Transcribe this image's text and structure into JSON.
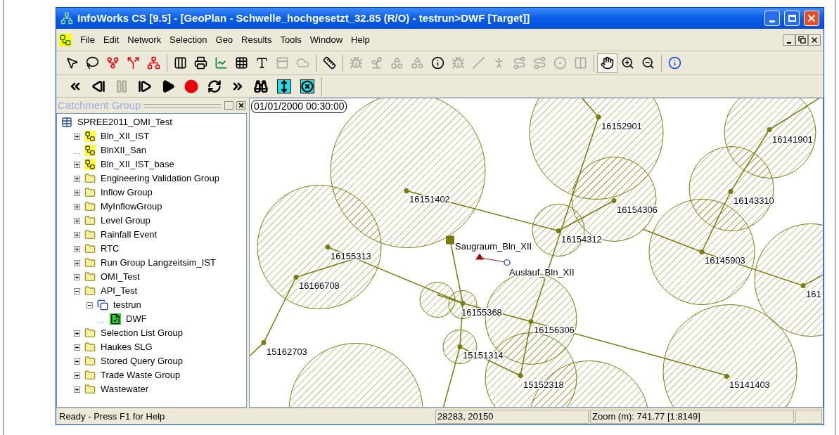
{
  "window": {
    "title": "InfoWorks CS [9.5] - [GeoPlan - Schwelle_hochgesetzt_32.85 (R/O) - testrun>DWF  [Target]]"
  },
  "menu": [
    "File",
    "Edit",
    "Network",
    "Selection",
    "Geo",
    "Results",
    "Tools",
    "Window",
    "Help"
  ],
  "toolbar": [
    {
      "disabled": false,
      "selected": false
    },
    {
      "disabled": false,
      "selected": false
    },
    {
      "disabled": false,
      "selected": false
    },
    {
      "disabled": false,
      "selected": false
    },
    {
      "disabled": false,
      "selected": false
    },
    {
      "disabled": false,
      "selected": false
    },
    {
      "disabled": false,
      "selected": false
    },
    {
      "disabled": false,
      "selected": false
    },
    {
      "disabled": false,
      "selected": false
    },
    {
      "disabled": false,
      "selected": false
    },
    {
      "disabled": true,
      "selected": false
    },
    {
      "disabled": true,
      "selected": false
    },
    {
      "disabled": false,
      "selected": false
    },
    {
      "disabled": true,
      "selected": false
    },
    {
      "disabled": true,
      "selected": false
    },
    {
      "disabled": true,
      "selected": false
    },
    {
      "disabled": true,
      "selected": false
    },
    {
      "disabled": false,
      "selected": false
    },
    {
      "disabled": true,
      "selected": false
    },
    {
      "disabled": true,
      "selected": false
    },
    {
      "disabled": true,
      "selected": false
    },
    {
      "disabled": true,
      "selected": false
    },
    {
      "disabled": true,
      "selected": false
    },
    {
      "disabled": true,
      "selected": false
    },
    {
      "disabled": true,
      "selected": false
    },
    {
      "disabled": false,
      "selected": true
    },
    {
      "disabled": false,
      "selected": false
    },
    {
      "disabled": false,
      "selected": false
    },
    {
      "disabled": false,
      "selected": false
    }
  ],
  "playback": [
    {
      "disabled": false
    },
    {
      "disabled": false
    },
    {
      "disabled": true
    },
    {
      "disabled": false
    },
    {
      "disabled": false
    },
    {
      "disabled": false
    },
    {
      "disabled": false
    },
    {
      "disabled": false
    },
    {
      "disabled": false
    },
    {
      "disabled": false
    },
    {
      "disabled": false
    }
  ],
  "panel": {
    "title": "Catchment Group"
  },
  "tree": {
    "label": "SPREE2011_OMI_Test",
    "kind": "database",
    "children": [
      {
        "label": "Bln_XII_IST",
        "kind": "network",
        "expandable": true,
        "expanded": false
      },
      {
        "label": "BlnXII_San",
        "kind": "network",
        "expandable": false
      },
      {
        "label": "Bln_XII_IST_base",
        "kind": "network",
        "expandable": true,
        "expanded": false
      },
      {
        "label": "Engineering Validation Group",
        "kind": "folder",
        "expandable": true,
        "expanded": false
      },
      {
        "label": "Inflow Group",
        "kind": "folder",
        "expandable": true,
        "expanded": false
      },
      {
        "label": "MyInflowGroup",
        "kind": "folder",
        "expandable": true,
        "expanded": false
      },
      {
        "label": "Level Group",
        "kind": "folder",
        "expandable": true,
        "expanded": false
      },
      {
        "label": "Rainfall Event",
        "kind": "folder",
        "expandable": true,
        "expanded": false
      },
      {
        "label": "RTC",
        "kind": "folder",
        "expandable": true,
        "expanded": false
      },
      {
        "label": "Run Group Langzeitsim_IST",
        "kind": "folder",
        "expandable": true,
        "expanded": false
      },
      {
        "label": "OMI_Test",
        "kind": "folder",
        "expandable": true,
        "expanded": false
      },
      {
        "label": "API_Test",
        "kind": "folder",
        "expandable": true,
        "expanded": true,
        "children": [
          {
            "label": "testrun",
            "kind": "run",
            "expandable": true,
            "expanded": true,
            "children": [
              {
                "label": "DWF",
                "kind": "sim",
                "expandable": false
              }
            ]
          }
        ]
      },
      {
        "label": "Selection List Group",
        "kind": "folder",
        "expandable": true,
        "expanded": false
      },
      {
        "label": "Haukes SLG",
        "kind": "folder",
        "expandable": true,
        "expanded": false
      },
      {
        "label": "Stored Query Group",
        "kind": "folder",
        "expandable": true,
        "expanded": false
      },
      {
        "label": "Trade Waste Group",
        "kind": "folder",
        "expandable": true,
        "expanded": false
      },
      {
        "label": "Wastewater",
        "kind": "folder",
        "expandable": true,
        "expanded": false
      }
    ]
  },
  "map": {
    "timestamp": "01/01/2000 00:30:00",
    "nodes": [
      {
        "label": "16152901",
        "kind": "node"
      },
      {
        "label": "16141901",
        "kind": "node"
      },
      {
        "label": "16151402",
        "kind": "node"
      },
      {
        "label": "16154306",
        "kind": "node"
      },
      {
        "label": "16143310",
        "kind": "node"
      },
      {
        "label": "16154312",
        "kind": "node"
      },
      {
        "label": "Saugraum_Bln_XII",
        "kind": "storage"
      },
      {
        "label": "16155313",
        "kind": "node"
      },
      {
        "label": "Auslauf_Bln_XII",
        "kind": "outfall"
      },
      {
        "label": "16145903",
        "kind": "node"
      },
      {
        "label": "16166708",
        "kind": "node"
      },
      {
        "label": "161",
        "kind": "node"
      },
      {
        "label": "16155368",
        "kind": "node"
      },
      {
        "label": "16156306",
        "kind": "node"
      },
      {
        "label": "15162703",
        "kind": "node"
      },
      {
        "label": "15151314",
        "kind": "node"
      },
      {
        "label": "15152318",
        "kind": "node"
      },
      {
        "label": "15141403",
        "kind": "node"
      }
    ]
  },
  "status_bar": [
    "Ready - Press F1 for Help",
    "28283, 20150",
    "Zoom (m): 741.77 [1:8149]"
  ]
}
